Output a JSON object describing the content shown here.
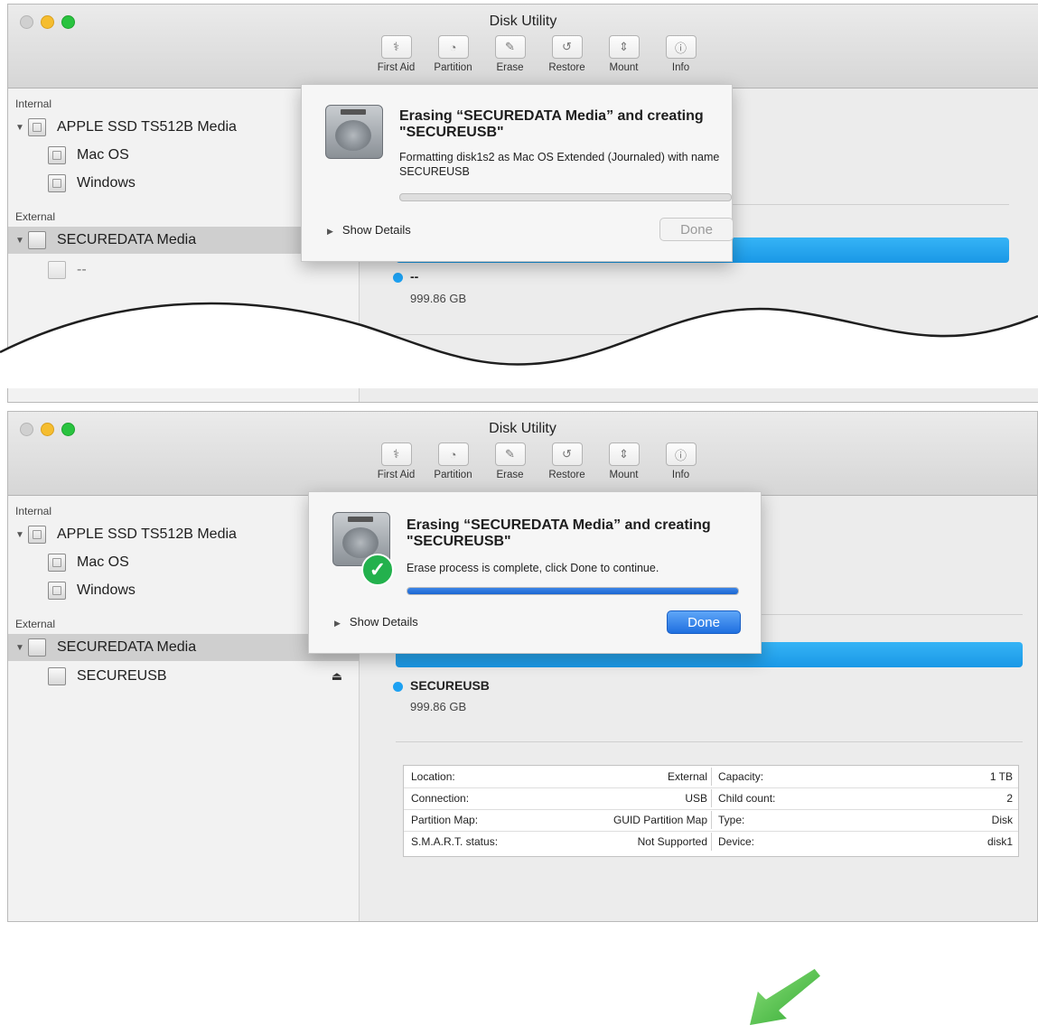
{
  "window": {
    "title": "Disk Utility",
    "toolbar": [
      {
        "label": "First Aid",
        "icon": "stethoscope-icon",
        "glyph": "⚕"
      },
      {
        "label": "Partition",
        "icon": "partition-icon",
        "glyph": "◔"
      },
      {
        "label": "Erase",
        "icon": "erase-icon",
        "glyph": "✎"
      },
      {
        "label": "Restore",
        "icon": "restore-icon",
        "glyph": "↺"
      },
      {
        "label": "Mount",
        "icon": "mount-icon",
        "glyph": "⇕"
      },
      {
        "label": "Info",
        "icon": "info-icon",
        "glyph": "ⓘ"
      }
    ]
  },
  "sidebar": {
    "internal_header": "Internal",
    "external_header": "External",
    "internal_disk": "APPLE SSD TS512B Media",
    "volumes": [
      "Mac OS",
      "Windows"
    ],
    "external_disk": "SECUREDATA Media"
  },
  "top": {
    "external_volume": "--",
    "sheet": {
      "title": "Erasing “SECUREDATA Media” and creating \"SECUREUSB\"",
      "message": "Formatting disk1s2 as Mac OS Extended (Journaled) with name SECUREUSB",
      "progress": 0.0,
      "show_details": "Show Details",
      "done": "Done"
    },
    "volume_name": "--",
    "volume_size": "999.86 GB"
  },
  "bottom": {
    "external_volume": "SECUREUSB",
    "sheet": {
      "title": "Erasing “SECUREDATA Media” and creating \"SECUREUSB\"",
      "message": "Erase process is complete, click Done to continue.",
      "progress": 1.0,
      "show_details": "Show Details",
      "done": "Done"
    },
    "volume_name": "SECUREUSB",
    "volume_size": "999.86 GB",
    "info_table": [
      {
        "l_key": "Location:",
        "l_val": "External",
        "r_key": "Capacity:",
        "r_val": "1 TB"
      },
      {
        "l_key": "Connection:",
        "l_val": "USB",
        "r_key": "Child count:",
        "r_val": "2"
      },
      {
        "l_key": "Partition Map:",
        "l_val": "GUID Partition Map",
        "r_key": "Type:",
        "r_val": "Disk"
      },
      {
        "l_key": "S.M.A.R.T. status:",
        "l_val": "Not Supported",
        "r_key": "Device:",
        "r_val": "disk1"
      }
    ]
  },
  "colors": {
    "accent_blue": "#1da1f2",
    "progress_blue": "#1b66d1",
    "arrow_green": "#4cc24a"
  }
}
